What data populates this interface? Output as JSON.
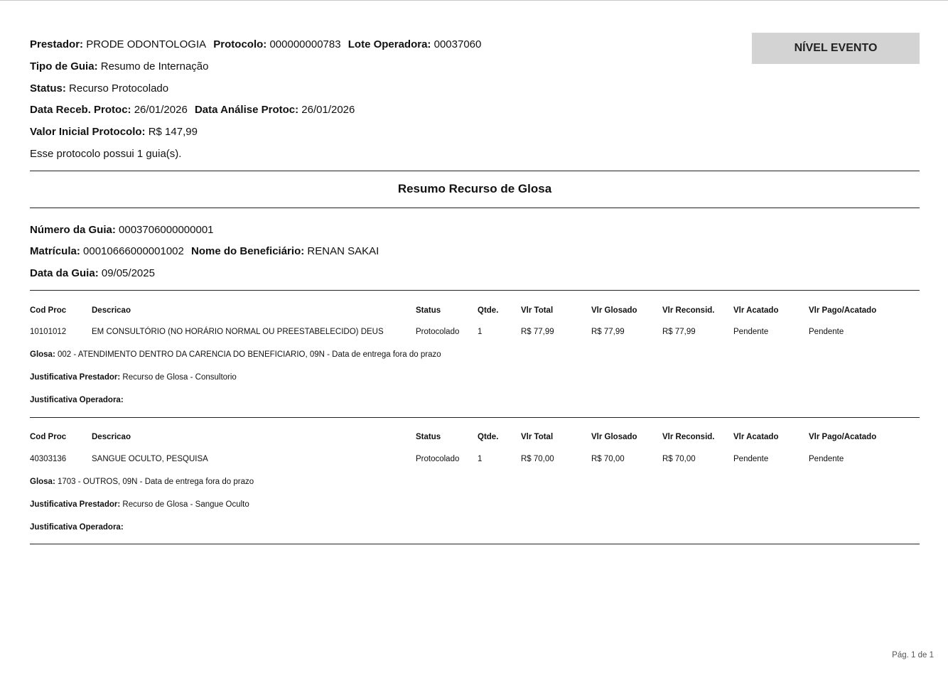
{
  "header": {
    "prestador_label": "Prestador:",
    "prestador_value": "PRODE ODONTOLOGIA",
    "protocolo_label": "Protocolo:",
    "protocolo_value": "000000000783",
    "lote_label": "Lote Operadora:",
    "lote_value": "00037060",
    "tipo_label": "Tipo de Guia:",
    "tipo_value": "Resumo de Internação",
    "status_label": "Status:",
    "status_value": "Recurso Protocolado",
    "data_receb_label": "Data Receb. Protoc:",
    "data_receb_value": "26/01/2026",
    "data_analise_label": "Data Análise Protoc:",
    "data_analise_value": "26/01/2026",
    "valor_label": "Valor Inicial Protocolo:",
    "valor_value": "R$ 147,99",
    "guias_text": "Esse protocolo possui 1 guia(s).",
    "badge": "NÍVEL EVENTO"
  },
  "section_title": "Resumo Recurso de Glosa",
  "guia": {
    "numero_label": "Número da Guia:",
    "numero_value": "0003706000000001",
    "matricula_label": "Matrícula:",
    "matricula_value": "00010666000001002",
    "beneficiario_label": "Nome do Beneficiário:",
    "beneficiario_value": "RENAN SAKAI",
    "data_label": "Data da Guia:",
    "data_value": "09/05/2025"
  },
  "columns": [
    "Cod Proc",
    "Descricao",
    "Status",
    "Qtde.",
    "Vlr Total",
    "Vlr Glosado",
    "Vlr Reconsid.",
    "Vlr Acatado",
    "Vlr Pago/Acatado"
  ],
  "labels": {
    "glosa": "Glosa:",
    "just_prestador": "Justificativa Prestador:",
    "just_operadora": "Justificativa Operadora:"
  },
  "items": [
    {
      "cells": [
        "10101012",
        "EM CONSULTÓRIO (NO HORÁRIO NORMAL OU PREESTABELECIDO) DEUS",
        "Protocolado",
        "1",
        "R$ 77,99",
        "R$ 77,99",
        "R$ 77,99",
        "Pendente",
        "Pendente"
      ],
      "glosa": "002 - ATENDIMENTO DENTRO DA CARENCIA DO BENEFICIARIO, 09N - Data de entrega fora do prazo",
      "just_prestador": "Recurso de Glosa - Consultorio",
      "just_operadora": ""
    },
    {
      "cells": [
        "40303136",
        "SANGUE OCULTO, PESQUISA",
        "Protocolado",
        "1",
        "R$ 70,00",
        "R$ 70,00",
        "R$ 70,00",
        "Pendente",
        "Pendente"
      ],
      "glosa": "1703 - OUTROS, 09N - Data de entrega fora do prazo",
      "just_prestador": "Recurso de Glosa - Sangue Oculto",
      "just_operadora": ""
    }
  ],
  "footer": "Pág. 1 de 1"
}
